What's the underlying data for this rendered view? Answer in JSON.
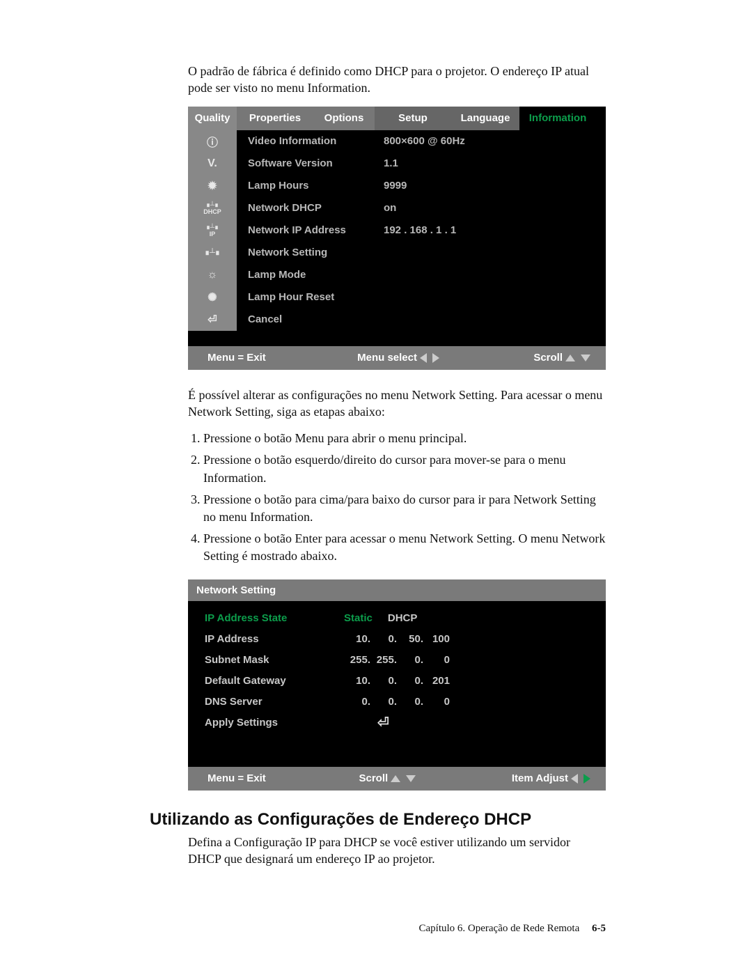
{
  "intro": "O padrão de fábrica é definido como DHCP para o projetor. O endereço IP atual pode ser visto no menu Information.",
  "menu1": {
    "tabs": [
      "Quality",
      "Properties",
      "Options",
      "Setup",
      "Language",
      "Information"
    ],
    "rows": [
      {
        "label": "Video Information",
        "value": "800×600 @ 60Hz"
      },
      {
        "label": "Software Version",
        "value": "1.1"
      },
      {
        "label": "Lamp Hours",
        "value": "9999"
      },
      {
        "label": "Network DHCP",
        "value": "on"
      },
      {
        "label": "Network IP Address",
        "value": "192 . 168 . 1 . 1"
      },
      {
        "label": "Network Setting",
        "value": ""
      },
      {
        "label": "Lamp Mode",
        "value": ""
      },
      {
        "label": "Lamp Hour Reset",
        "value": ""
      },
      {
        "label": "Cancel",
        "value": ""
      }
    ],
    "foot": {
      "exit": "Menu = Exit",
      "select": "Menu select",
      "scroll": "Scroll"
    }
  },
  "para2": "É possível alterar as configurações no menu Network Setting. Para acessar o menu Network Setting, siga as etapas abaixo:",
  "steps": [
    "Pressione o botão Menu para abrir o menu principal.",
    "Pressione o botão esquerdo/direito do cursor para mover-se para o menu Information.",
    "Pressione o botão para cima/para baixo do cursor para ir para Network Setting no menu Information.",
    "Pressione o botão Enter para acessar o menu Network Setting. O menu Network Setting é mostrado abaixo."
  ],
  "menu2": {
    "title": "Network Setting",
    "rows": [
      {
        "label": "IP Address State",
        "type": "opts",
        "opts": [
          "Static",
          "DHCP"
        ],
        "selected": 0
      },
      {
        "label": "IP Address",
        "type": "ip",
        "oct": [
          "10.",
          "0.",
          "50.",
          "100"
        ]
      },
      {
        "label": "Subnet Mask",
        "type": "ip",
        "oct": [
          "255.",
          "255.",
          "0.",
          "0"
        ]
      },
      {
        "label": "Default Gateway",
        "type": "ip",
        "oct": [
          "10.",
          "0.",
          "0.",
          "201"
        ]
      },
      {
        "label": "DNS Server",
        "type": "ip",
        "oct": [
          "0.",
          "0.",
          "0.",
          "0"
        ]
      },
      {
        "label": "Apply Settings",
        "type": "enter"
      }
    ],
    "foot": {
      "exit": "Menu = Exit",
      "scroll": "Scroll",
      "adjust": "Item Adjust"
    }
  },
  "heading": "Utilizando as Configurações de Endereço DHCP",
  "para3": "Defina a Configuração IP para DHCP se você estiver utilizando um servidor DHCP que designará um endereço IP ao projetor.",
  "footer": {
    "chapter": "Capítulo 6. Operação de Rede Remota",
    "page": "6-5"
  }
}
